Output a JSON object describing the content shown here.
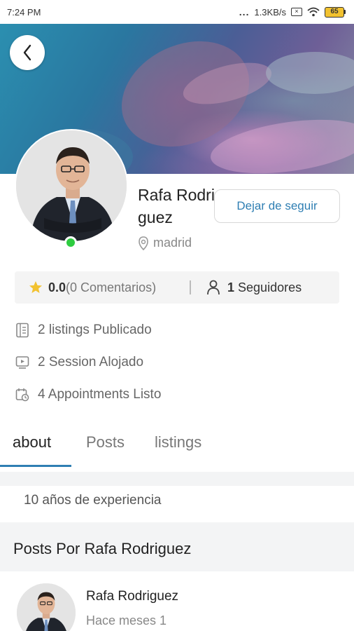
{
  "status_bar": {
    "time": "7:24 PM",
    "dots": "...",
    "network_speed": "1.3KB/s",
    "battery": "65"
  },
  "profile": {
    "name": "Rafa Rodriguez",
    "location": "madrid",
    "online": true,
    "unfollow_label": "Dejar de seguir"
  },
  "stats": {
    "rating": "0.0",
    "comments": "(0 Comentarios)",
    "followers_count": "1",
    "followers_label": "Seguidores"
  },
  "info_rows": [
    {
      "icon": "listings-icon",
      "text": "2 listings Publicado"
    },
    {
      "icon": "session-icon",
      "text": "2 Session Alojado"
    },
    {
      "icon": "appointments-icon",
      "text": "4 Appointments Listo"
    }
  ],
  "tabs": [
    {
      "label": "about",
      "active": true
    },
    {
      "label": "Posts",
      "active": false
    },
    {
      "label": "listings",
      "active": false
    }
  ],
  "about": {
    "text": "10 años de experiencia"
  },
  "posts": {
    "section_title": "Posts Por Rafa Rodriguez",
    "items": [
      {
        "author": "Rafa Rodriguez",
        "time": "Hace meses 1"
      }
    ]
  },
  "colors": {
    "accent": "#2f7fb3",
    "online": "#2ecc40",
    "star": "#f2c230"
  }
}
